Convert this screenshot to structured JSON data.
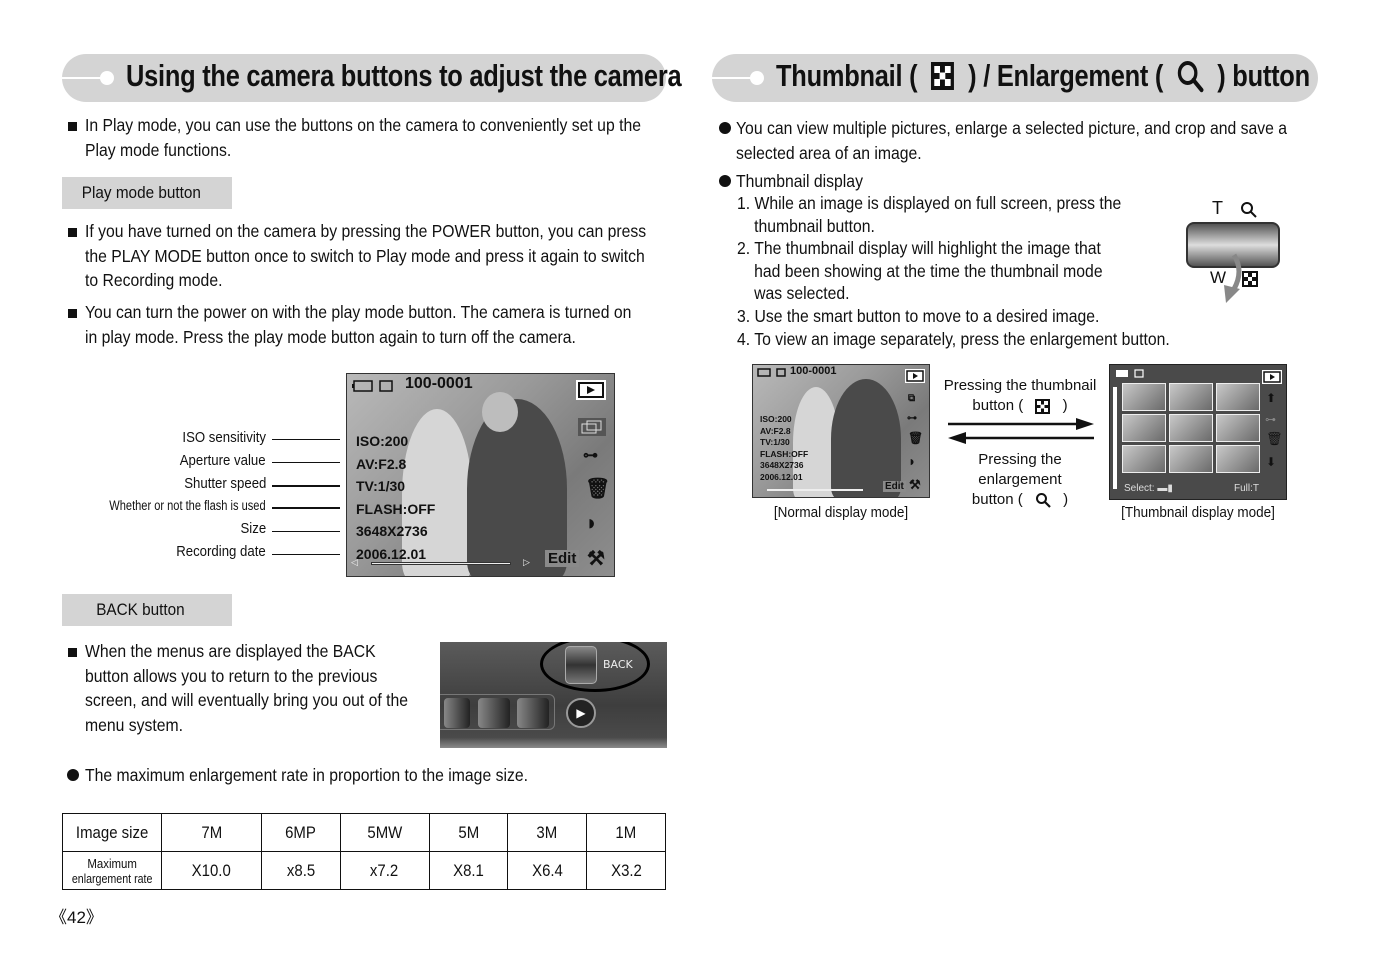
{
  "left": {
    "title": "Using the camera buttons to adjust the camera",
    "intro": [
      "In Play mode, you can use the buttons on the camera to conveniently set up the",
      "Play mode functions."
    ],
    "play_mode_section": {
      "label": "Play mode button",
      "paragraphs": [
        [
          "If you have turned on the camera by pressing the POWER button, you can press",
          "the PLAY MODE button once to switch to Play mode and press it again to switch",
          "to Recording mode."
        ],
        [
          "You can turn the power on with the play mode button. The camera is turned on",
          "in play mode. Press the play mode button again to turn off the camera."
        ]
      ]
    },
    "lcd": {
      "file_number": "100-0001",
      "edit_label": "Edit",
      "values": [
        "ISO:200",
        "AV:F2.8",
        "TV:1/30",
        "FLASH:OFF",
        "3648X2736",
        "2006.12.01"
      ],
      "callouts": [
        "ISO sensitivity",
        "Aperture value",
        "Shutter speed",
        "Whether or not the flash is used",
        "Size",
        "Recording date"
      ],
      "icons": [
        "play-mode-icon",
        "slideshow-icon",
        "protect-key-icon",
        "delete-icon",
        "rotate-icon",
        "setup-wrench-icon"
      ]
    },
    "back_section": {
      "label": "BACK button",
      "paragraph": [
        "When the menus are displayed the BACK",
        "button allows you to return to the previous",
        "screen, and will eventually bring you out of the",
        "menu system."
      ],
      "camera_button_label": "BACK"
    },
    "enlargement_note": "The maximum enlargement rate in proportion to the image size.",
    "table": {
      "header_label": "Image size",
      "row_label": [
        "Maximum",
        "enlargement rate"
      ],
      "sizes": [
        "7M",
        "6MP",
        "5MW",
        "5M",
        "3M",
        "1M"
      ],
      "rates": [
        "X10.0",
        "x8.5",
        "x7.2",
        "X8.1",
        "X6.4",
        "X3.2"
      ]
    },
    "page_number": "《42》"
  },
  "right": {
    "title_part1": "Thumbnail (",
    "title_part2": ") / Enlargement (",
    "title_part3": ") button",
    "intro": [
      "You can view multiple pictures, enlarge a selected picture, and crop and save a",
      "selected area of an image."
    ],
    "thumbnail_heading": "Thumbnail display",
    "steps": [
      [
        "1. While an image is displayed on full screen, press the",
        "thumbnail  button."
      ],
      [
        "2. The thumbnail display will highlight the image that",
        "had been showing at the time the thumbnail mode",
        "was selected."
      ],
      [
        "3. Use the smart button to move to a desired image."
      ],
      [
        "4. To view an image separately, press the enlargement button."
      ]
    ],
    "zoom_lever": {
      "tele": "T",
      "wide": "W"
    },
    "normal_lcd": {
      "file_number": "100-0001",
      "edit_label": "Edit",
      "values": [
        "ISO:200",
        "AV:F2.8",
        "TV:1/30",
        "FLASH:OFF",
        "3648X2736",
        "2006.12.01"
      ],
      "caption": "[Normal display mode]"
    },
    "arrows": {
      "forward": [
        "Pressing the thumbnail",
        "button (",
        ")"
      ],
      "backward": [
        "Pressing the enlargement",
        "button (",
        ")"
      ]
    },
    "thumb_lcd": {
      "select_label": "Select:",
      "full_label": "Full:T",
      "thumbnail_count": 9,
      "caption": "[Thumbnail display mode]"
    }
  }
}
